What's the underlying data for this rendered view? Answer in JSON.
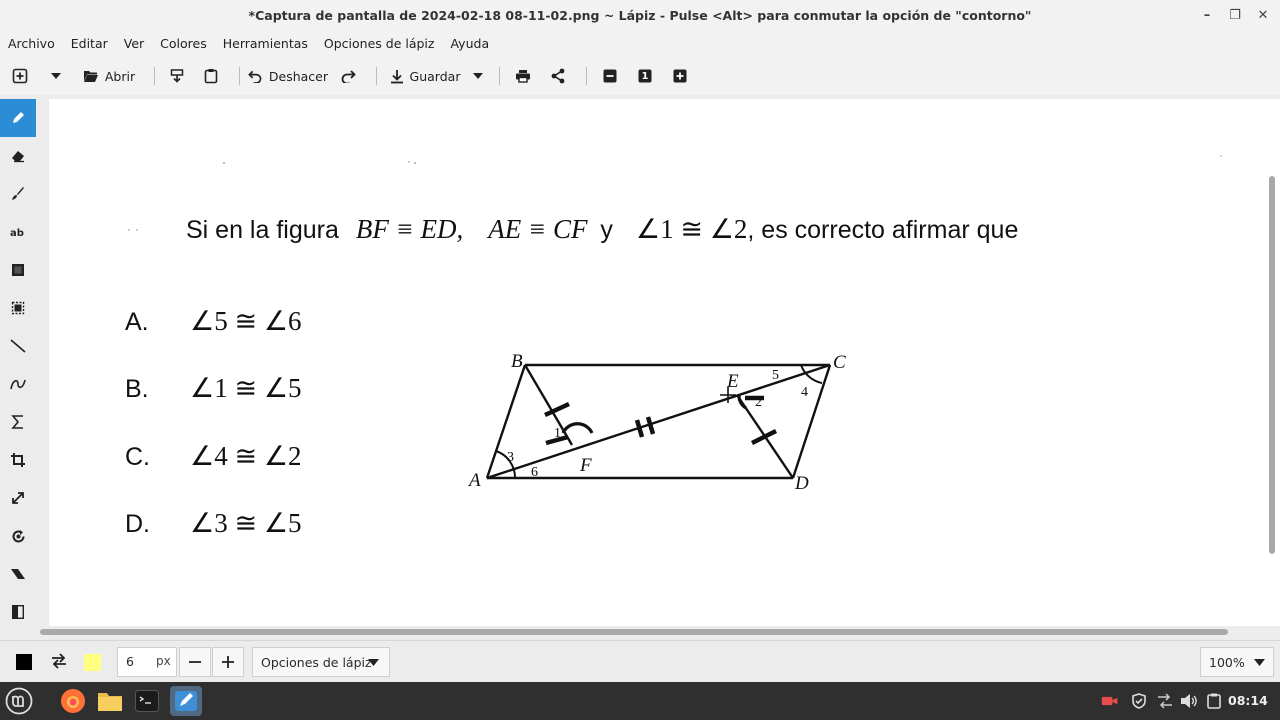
{
  "window": {
    "title": "*Captura de pantalla de 2024-02-18 08-11-02.png ~ Lápiz - Pulse <Alt> para conmutar la opción de \"contorno\""
  },
  "menu": [
    "Archivo",
    "Editar",
    "Ver",
    "Colores",
    "Herramientas",
    "Opciones de lápiz",
    "Ayuda"
  ],
  "toolbar": {
    "open": "Abrir",
    "undo": "Deshacer",
    "save": "Guardar",
    "zoom_reset": "1"
  },
  "canvas": {
    "question": {
      "prefix": "Si en la figura",
      "seg1": "BF ≡ ED,",
      "seg2": "AE ≡ CF",
      "conj": "y",
      "angles": "∠1 ≅ ∠2",
      "suffix": ", es correcto afirmar que"
    },
    "options": [
      {
        "letter": "A.",
        "value": "∠5 ≅ ∠6"
      },
      {
        "letter": "B.",
        "value": "∠1 ≅ ∠5"
      },
      {
        "letter": "C.",
        "value": "∠4 ≅ ∠2"
      },
      {
        "letter": "D.",
        "value": "∠3 ≅ ∠5"
      }
    ],
    "figure_labels": {
      "A": "A",
      "B": "B",
      "C": "C",
      "D": "D",
      "E": "E",
      "F": "F",
      "n1": "1",
      "n2": "2",
      "n3": "3",
      "n4": "4",
      "n5": "5",
      "n6": "6"
    }
  },
  "bottom": {
    "brush_size": "6",
    "unit": "px",
    "pencil_options": "Opciones de lápiz",
    "zoom": "100%"
  },
  "taskbar": {
    "clock": "08:14"
  },
  "colors": {
    "primary": "#000000",
    "secondary": "#ffff80",
    "active_tool": "#2b8dd6",
    "taskbar": "#2f2f2f"
  }
}
